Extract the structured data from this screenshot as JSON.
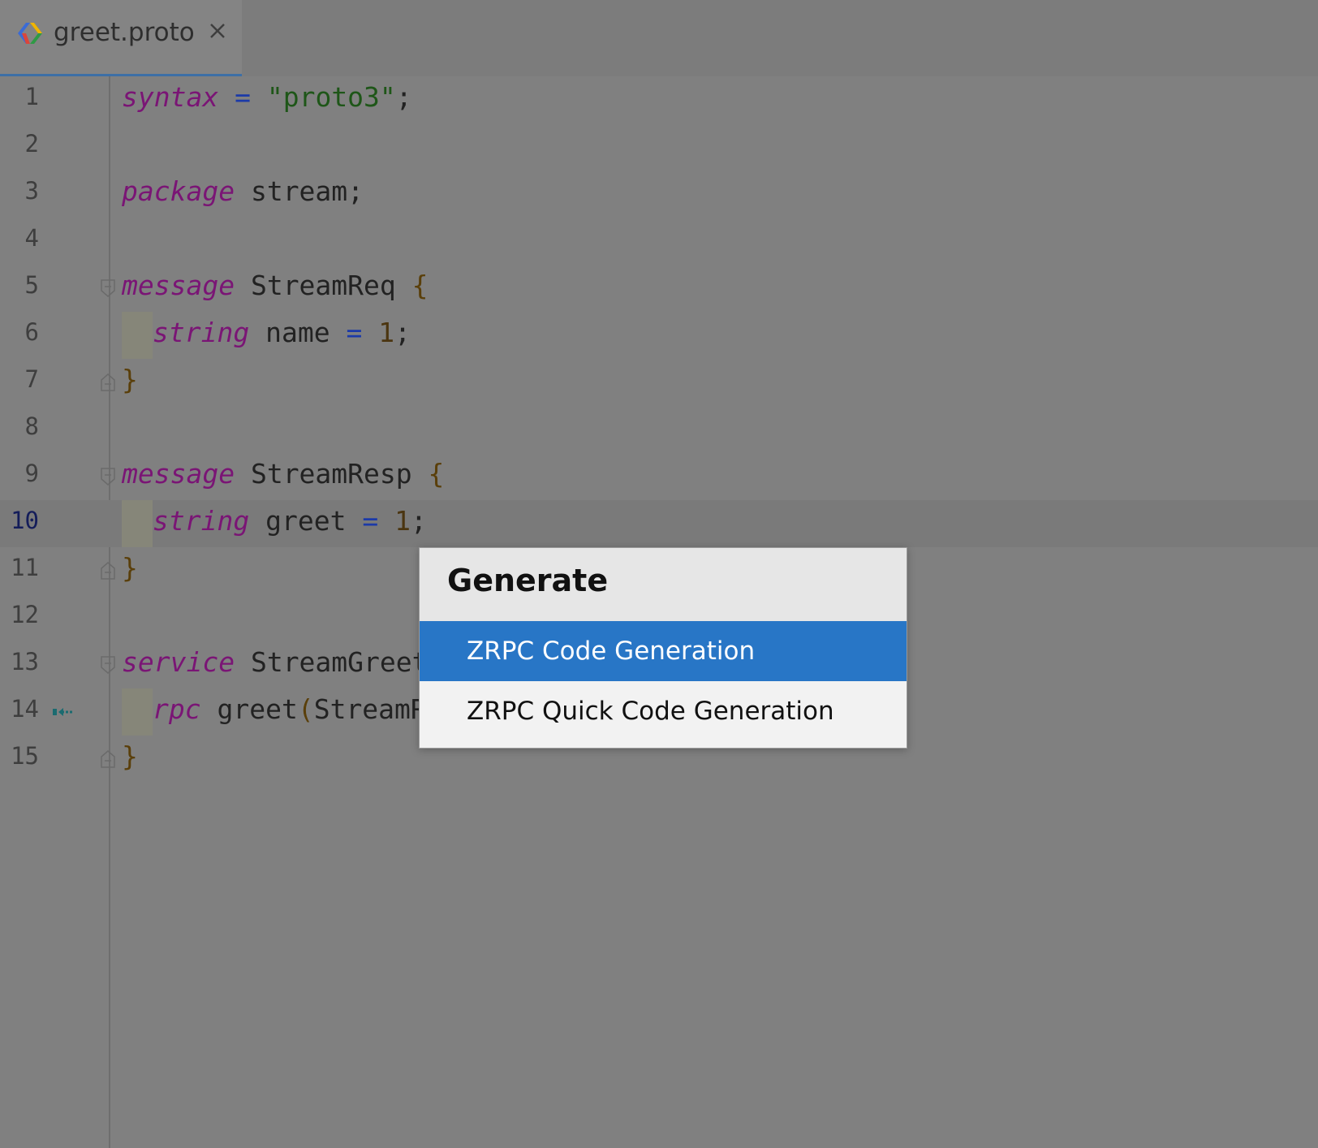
{
  "tab": {
    "file_name": "greet.proto",
    "icon": "protobuf-file-icon",
    "close_icon": "close-icon"
  },
  "editor": {
    "current_line": "10",
    "lines": [
      {
        "number": "1"
      },
      {
        "number": "2"
      },
      {
        "number": "3"
      },
      {
        "number": "4"
      },
      {
        "number": "5"
      },
      {
        "number": "6"
      },
      {
        "number": "7"
      },
      {
        "number": "8"
      },
      {
        "number": "9"
      },
      {
        "number": "10"
      },
      {
        "number": "11"
      },
      {
        "number": "12"
      },
      {
        "number": "13"
      },
      {
        "number": "14"
      },
      {
        "number": "15"
      }
    ],
    "code": {
      "l1": {
        "kw": "syntax",
        "op": "=",
        "str": "\"proto3\"",
        "end": ";"
      },
      "l3": {
        "kw": "package",
        "name": "stream;"
      },
      "l5": {
        "kw": "message",
        "name": "StreamReq",
        "brace": "{"
      },
      "l6": {
        "kw": "string",
        "name": "name",
        "op": "=",
        "num": "1",
        "end": ";"
      },
      "l7": {
        "brace": "}"
      },
      "l9": {
        "kw": "message",
        "name": "StreamResp",
        "brace": "{"
      },
      "l10": {
        "kw": "string",
        "name": "greet",
        "op": "=",
        "num": "1",
        "end": ";"
      },
      "l11": {
        "brace": "}"
      },
      "l13": {
        "kw": "service",
        "name": "StreamGreet"
      },
      "l14": {
        "kw": "rpc",
        "name": "greet",
        "paren": "(",
        "arg": "StreamR"
      },
      "l15": {
        "brace": "}"
      }
    },
    "gutter_icon": "implemented-method-arrow-icon"
  },
  "popup": {
    "title": "Generate",
    "items": [
      {
        "label": "ZRPC Code Generation",
        "selected": true
      },
      {
        "label": "ZRPC Quick Code Generation",
        "selected": false
      }
    ],
    "colors": {
      "selection": "#2876c6"
    }
  }
}
